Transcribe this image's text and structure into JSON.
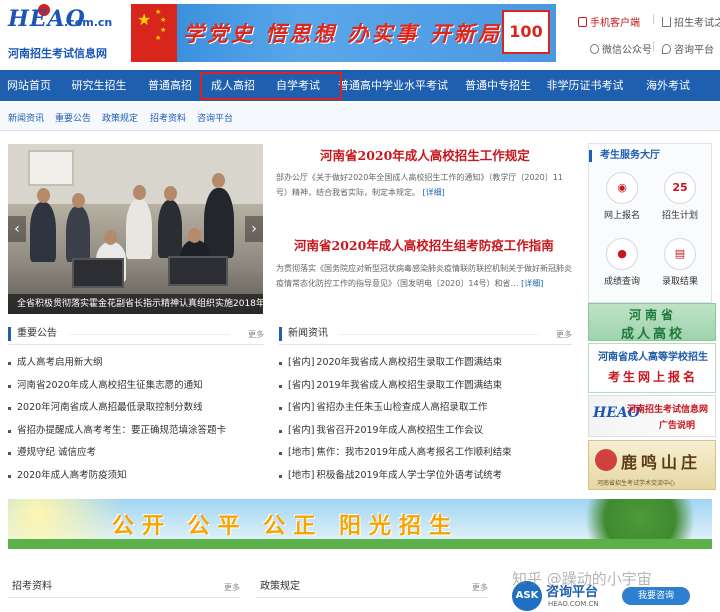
{
  "header": {
    "logo_mark": "HEAO",
    "logo_domain": ".com.cn",
    "logo_subtitle": "河南招生考试信息网",
    "banner_text": "学党史 悟思想 办实事 开新局",
    "banner_emblem": "100",
    "top_links": {
      "mobile": "手机客户端",
      "home": "招生考试之家",
      "wechat": "微信公众号",
      "consult": "咨询平台",
      "separator": "|"
    }
  },
  "nav": {
    "items": [
      "网站首页",
      "研究生招生",
      "普通高招",
      "成人高招",
      "自学考试",
      "普通高中学业水平考试",
      "普通中专招生",
      "非学历证书考试",
      "海外考试"
    ],
    "highlighted": [
      "成人高招",
      "自学考试"
    ]
  },
  "subnav": {
    "items": [
      "新闻资讯",
      "重要公告",
      "政策规定",
      "招考资料",
      "咨询平台"
    ]
  },
  "slider": {
    "caption": "全省积极贯彻落实霍金花副省长指示精神认真组织实施2018年",
    "prev": "‹",
    "next": "›"
  },
  "headlines": [
    {
      "title": "河南省2020年成人高校招生工作规定",
      "summary": "部办公厅《关于做好2020年全国成人高校招生工作的通知》（教学厅〔2020〕11号）精神，结合我省实际，制定本规定。",
      "more": "[详细]"
    },
    {
      "title": "河南省2020年成人高校招生组考防疫工作指南",
      "summary": "为贯彻落实《国务院应对新型冠状病毒感染肺炎疫情联防联控机制关于做好新冠肺炎疫情常态化防控工作的指导意见》（国发明电〔2020〕14号）和省…",
      "more": "[详细]"
    }
  ],
  "notices": {
    "title": "重要公告",
    "more": "更多",
    "items": [
      "成人高考启用新大纲",
      "河南省2020年成人高校招生征集志愿的通知",
      "2020年河南省成人高招最低录取控制分数线",
      "省招办提醒成人高考考生：要正确规范填涂答题卡",
      "遵规守纪 诚信应考",
      "2020年成人高考防疫须知"
    ]
  },
  "news": {
    "title": "新闻资讯",
    "more": "更多",
    "items": [
      {
        "tag": "[省内]",
        "text": "2020年我省成人高校招生录取工作圆满结束"
      },
      {
        "tag": "[省内]",
        "text": "2019年我省成人高校招生录取工作圆满结束"
      },
      {
        "tag": "[省内]",
        "text": "省招办主任朱玉山检查成人高招录取工作"
      },
      {
        "tag": "[省内]",
        "text": "我省召开2019年成人高校招生工作会议"
      },
      {
        "tag": "[地市]",
        "text": "焦作：我市2019年成人高考报名工作顺利结束"
      },
      {
        "tag": "[地市]",
        "text": "积极备战2019年成人学士学位外语考试统考"
      }
    ]
  },
  "service": {
    "title": "考生服务大厅",
    "items": [
      {
        "label": "网上报名",
        "glyph": "◉"
      },
      {
        "label": "招生计划",
        "glyph": "25"
      },
      {
        "label": "成绩查询",
        "glyph": "●"
      },
      {
        "label": "录取结果",
        "glyph": "▤"
      }
    ]
  },
  "ads": {
    "ad1_line1": "河南省",
    "ad1_line2": "成人高校",
    "ad2_line1": "河南省成人高等学校招生",
    "ad2_line2": "考生网上报名",
    "ad3_logo": "HEAO",
    "ad3_line1": "河南招生考试信息网",
    "ad3_line2": "广告说明",
    "ad4_line1": "鹿鸣山庄",
    "ad4_line2": "河南省招生考试学术交流中心"
  },
  "wide_banner": {
    "text": "公开 公平 公正 阳光招生"
  },
  "bottom": {
    "panel1_title": "招考资料",
    "panel1_more": "更多",
    "panel2_title": "政策规定",
    "panel2_more": "更多",
    "ask_circle": "ASK",
    "ask_title": "咨询平台",
    "ask_url": "HEAO.COM.CN",
    "ask_button": "我要咨询"
  },
  "watermark": "知乎 @躁动的小宇宙",
  "colors": {
    "nav_bg": "#1f5faf",
    "headline_red": "#c8161d",
    "highlight_border": "#e02020"
  }
}
